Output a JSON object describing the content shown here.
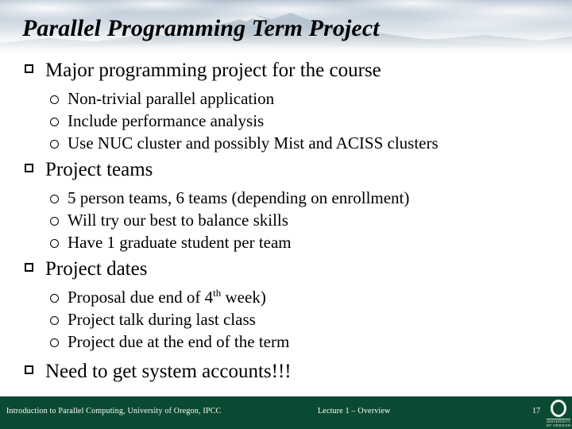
{
  "slide": {
    "title": "Parallel Programming Term Project",
    "header_image": "mountain-sky-photo-banner",
    "outline": [
      {
        "level": 1,
        "marker": "hollow-square-bullet",
        "text": "Major programming project for the course"
      },
      {
        "level": 2,
        "marker": "hollow-circle-bullet",
        "text": "Non-trivial parallel application"
      },
      {
        "level": 2,
        "marker": "hollow-circle-bullet",
        "text": "Include performance analysis"
      },
      {
        "level": 2,
        "marker": "hollow-circle-bullet",
        "text": "Use NUC cluster and possibly Mist and ACISS clusters"
      },
      {
        "level": 1,
        "marker": "hollow-square-bullet",
        "text": "Project teams"
      },
      {
        "level": 2,
        "marker": "hollow-circle-bullet",
        "text": "5 person teams, 6 teams (depending on enrollment)"
      },
      {
        "level": 2,
        "marker": "hollow-circle-bullet",
        "text": "Will try our best to balance skills"
      },
      {
        "level": 2,
        "marker": "hollow-circle-bullet",
        "text": "Have 1 graduate student per team"
      },
      {
        "level": 1,
        "marker": "hollow-square-bullet",
        "text": "Project dates"
      },
      {
        "level": 2,
        "marker": "hollow-circle-bullet",
        "text_before_sup": "Proposal due end of 4",
        "superscript": "th",
        "text_after_sup": " week)"
      },
      {
        "level": 2,
        "marker": "hollow-circle-bullet",
        "text": "Project talk during last class"
      },
      {
        "level": 2,
        "marker": "hollow-circle-bullet",
        "text": "Project due at the end of the term"
      },
      {
        "level": 1,
        "marker": "hollow-square-bullet",
        "text": "Need to get system accounts!!!"
      }
    ]
  },
  "footer": {
    "left_text": "Introduction to Parallel Computing, University of Oregon, IPCC",
    "center_text": "Lecture 1 – Overview",
    "page_number": "17",
    "logo": {
      "mark": "O",
      "caption_line_1": "UNIVERSITY",
      "caption_line_2": "OF OREGON"
    }
  },
  "colors": {
    "footer_background": "#0b4a32",
    "footer_text": "#ffffff",
    "body_text": "#000000",
    "slide_background": "#ffffff"
  }
}
